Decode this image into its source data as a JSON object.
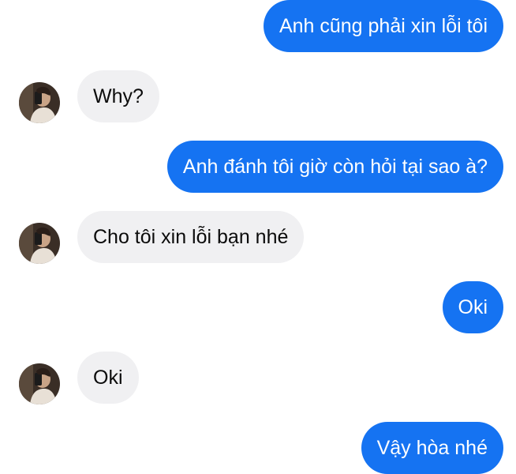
{
  "conversation": {
    "messages": [
      {
        "sender": "me",
        "text": "Anh cũng phải xin lỗi tôi"
      },
      {
        "sender": "other",
        "text": "Why?"
      },
      {
        "sender": "me",
        "text": "Anh đánh tôi giờ còn hỏi tại sao à?"
      },
      {
        "sender": "other",
        "text": "Cho tôi xin lỗi bạn nhé"
      },
      {
        "sender": "me",
        "text": "Oki"
      },
      {
        "sender": "other",
        "text": "Oki"
      },
      {
        "sender": "me",
        "text": "Vậy hòa nhé"
      }
    ]
  },
  "icons": {
    "avatar": "profile-photo-avatar"
  },
  "colors": {
    "outgoing_bubble": "#1573f2",
    "incoming_bubble": "#f0f0f2",
    "outgoing_text": "#ffffff",
    "incoming_text": "#0b0b0b"
  }
}
